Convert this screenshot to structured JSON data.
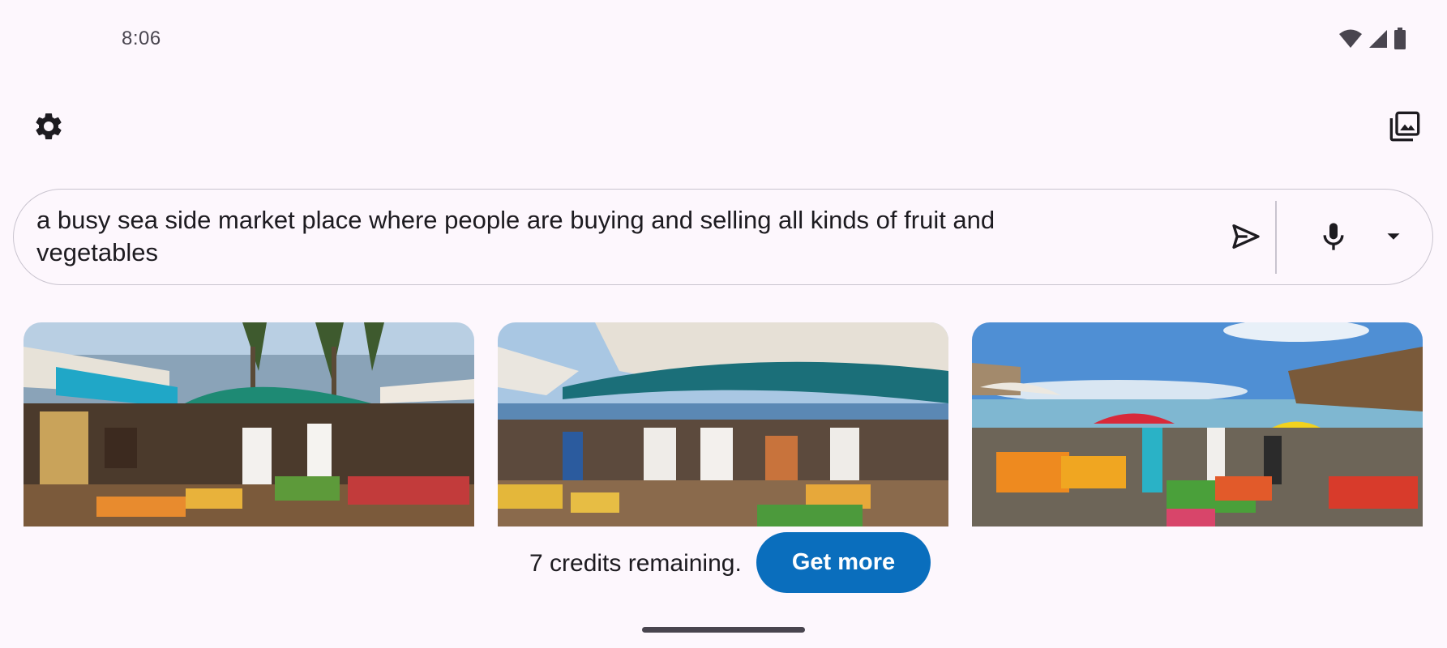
{
  "status_bar": {
    "time": "8:06",
    "icons": [
      "wifi-icon",
      "cell-signal-icon",
      "battery-icon"
    ]
  },
  "top_bar": {
    "settings_icon": "gear-icon",
    "gallery_icon": "image-gallery-icon"
  },
  "prompt": {
    "text": "a busy sea side market place where people are buying and selling all kinds of fruit and vegetables",
    "send_icon": "send-icon",
    "mic_icon": "mic-icon",
    "dropdown_icon": "dropdown-arrow-icon"
  },
  "images": [
    {
      "name": "generated-image-1"
    },
    {
      "name": "generated-image-2"
    },
    {
      "name": "generated-image-3"
    }
  ],
  "credits": {
    "text": "7 credits remaining.",
    "button_label": "Get more",
    "button_color": "#0a6ebd"
  },
  "colors": {
    "background": "#fdf7fd",
    "accent": "#0a6ebd",
    "outline": "#c9c4cf"
  }
}
